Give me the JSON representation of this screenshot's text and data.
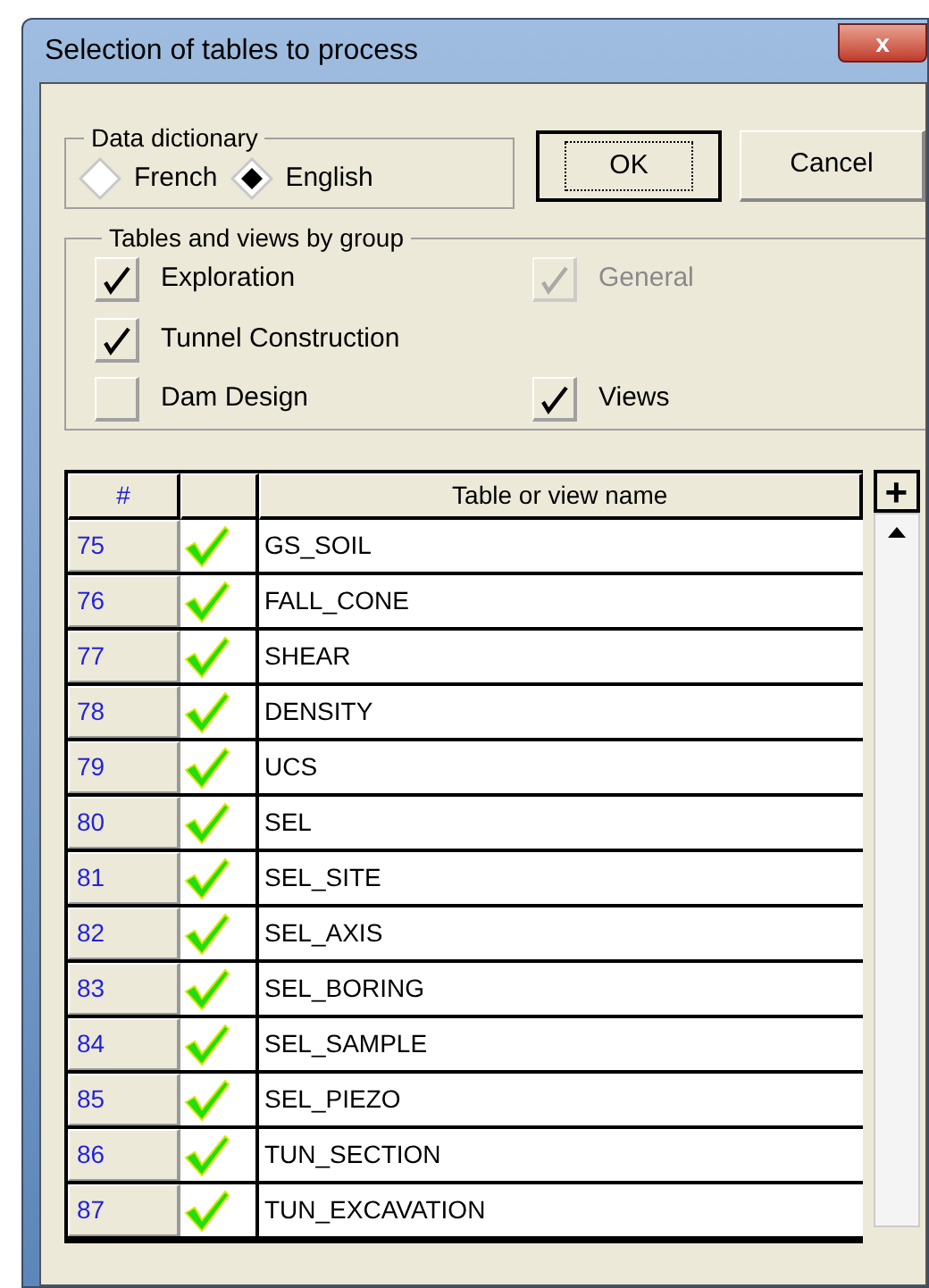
{
  "window": {
    "title": "Selection of tables to process",
    "close": "x"
  },
  "data_dictionary": {
    "label": "Data dictionary",
    "options": [
      {
        "label": "French",
        "selected": false
      },
      {
        "label": "English",
        "selected": true
      }
    ]
  },
  "buttons": [
    {
      "label": "OK",
      "default": true
    },
    {
      "label": "Cancel",
      "default": false
    }
  ],
  "groups": {
    "label": "Tables and views by group",
    "columns": [
      [
        {
          "label": "Exploration",
          "checked": true,
          "disabled": false
        },
        {
          "label": "Tunnel Construction",
          "checked": true,
          "disabled": false
        },
        {
          "label": "Dam Design",
          "checked": false,
          "disabled": false
        }
      ],
      [
        {
          "label": "General",
          "checked": true,
          "disabled": true
        },
        {
          "label": "Views",
          "checked": true,
          "disabled": false
        }
      ]
    ]
  },
  "table": {
    "columns": [
      "#",
      "",
      "Table or view name"
    ],
    "expand": "+",
    "rows": [
      {
        "number": "75",
        "checked": true,
        "name": "GS_SOIL"
      },
      {
        "number": "76",
        "checked": true,
        "name": "FALL_CONE"
      },
      {
        "number": "77",
        "checked": true,
        "name": "SHEAR"
      },
      {
        "number": "78",
        "checked": true,
        "name": "DENSITY"
      },
      {
        "number": "79",
        "checked": true,
        "name": "UCS"
      },
      {
        "number": "80",
        "checked": true,
        "name": "SEL"
      },
      {
        "number": "81",
        "checked": true,
        "name": "SEL_SITE"
      },
      {
        "number": "82",
        "checked": true,
        "name": "SEL_AXIS"
      },
      {
        "number": "83",
        "checked": true,
        "name": "SEL_BORING"
      },
      {
        "number": "84",
        "checked": true,
        "name": "SEL_SAMPLE"
      },
      {
        "number": "85",
        "checked": true,
        "name": "SEL_PIEZO"
      },
      {
        "number": "86",
        "checked": true,
        "name": "TUN_SECTION"
      },
      {
        "number": "87",
        "checked": true,
        "name": "TUN_EXCAVATION"
      }
    ]
  }
}
